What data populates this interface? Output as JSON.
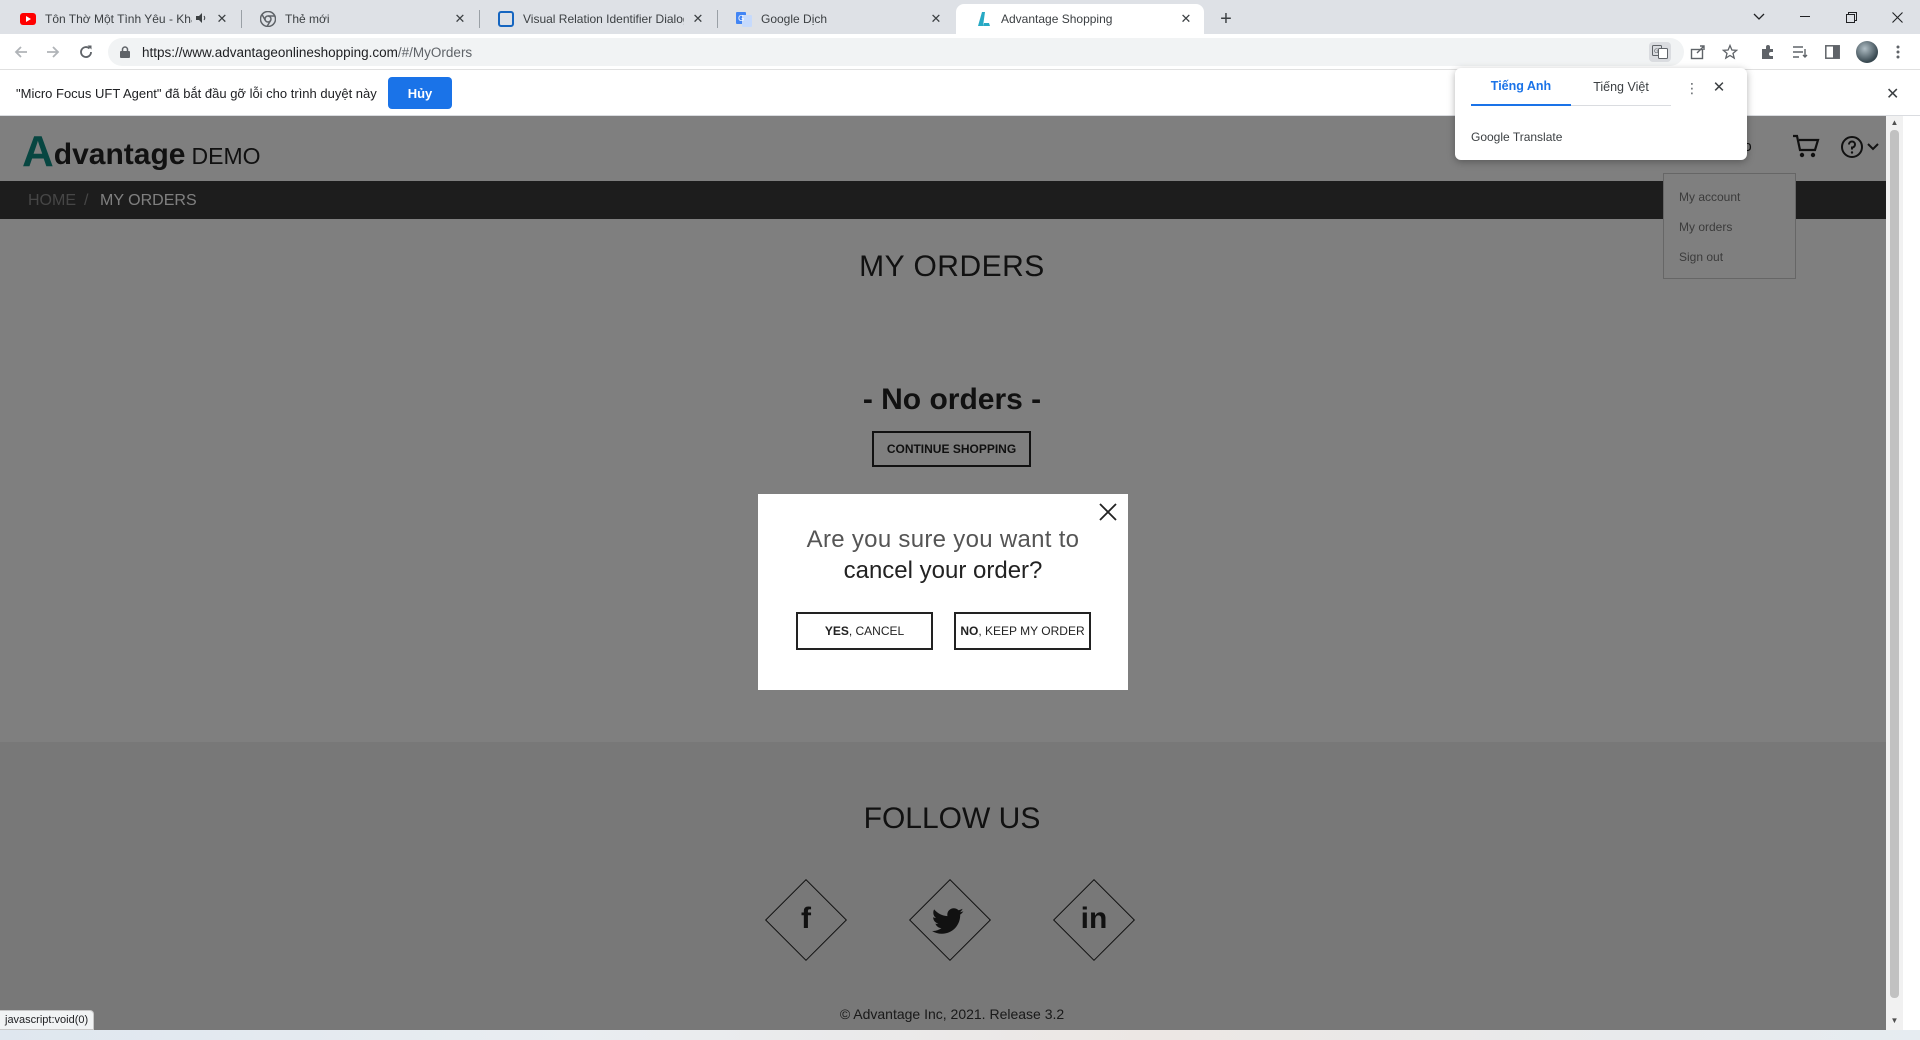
{
  "browser": {
    "tabs": [
      {
        "title": "Tôn Thờ Một Tình Yêu - Khán",
        "favicon": "youtube-icon"
      },
      {
        "title": "Thẻ mới",
        "favicon": "chrome-icon"
      },
      {
        "title": "Visual Relation Identifier Dialog E",
        "favicon": "uft-icon"
      },
      {
        "title": "Google Dịch",
        "favicon": "google-translate-icon"
      },
      {
        "title": "Advantage Shopping",
        "favicon": "advantage-icon"
      }
    ],
    "active_tab_index": 4,
    "url_host": "https://www.advantageonlineshopping.com",
    "url_path": "/#/MyOrders"
  },
  "infobar": {
    "message": "\"Micro Focus UFT Agent\" đã bắt đầu gỡ lỗi cho trình duyệt này",
    "cancel_label": "Hủy"
  },
  "translate_popup": {
    "tab_source": "Tiếng Anh",
    "tab_target": "Tiếng Việt",
    "brand": "Google Translate"
  },
  "site": {
    "logo_mark": "A",
    "logo_text": "dvantage",
    "logo_suffix": "DEMO",
    "user_name_fragment": "no",
    "breadcrumb_home": "HOME",
    "breadcrumb_sep": "/",
    "breadcrumb_current": "MY ORDERS",
    "user_menu": [
      "My account",
      "My orders",
      "Sign out"
    ],
    "page_title": "MY ORDERS",
    "empty_message": "- No orders -",
    "continue_label": "CONTINUE SHOPPING",
    "follow_title": "FOLLOW US",
    "social": [
      "f",
      "in"
    ],
    "copyright": "© Advantage Inc, 2021. Release 3.2"
  },
  "modal": {
    "question_line1": "Are you sure you want to",
    "question_line2": "cancel your order?",
    "yes_bold": "YES",
    "yes_rest": ", CANCEL",
    "no_bold": "NO",
    "no_rest": ", KEEP MY ORDER"
  },
  "status_bar": "javascript:void(0)",
  "colors": {
    "brand_teal": "#0f8c82",
    "chrome_blue": "#1a73e8",
    "breadcrumb_bg": "#3a3a3a"
  }
}
